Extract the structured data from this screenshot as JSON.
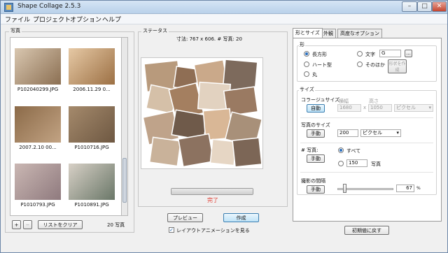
{
  "window": {
    "title": "Shape Collage 2.5.3"
  },
  "menu": [
    "ファイル",
    "プロジェクト",
    "オプション",
    "ヘルプ"
  ],
  "photos_panel": {
    "label": "写真",
    "items": [
      {
        "filename": "P102040299.JPG"
      },
      {
        "filename": "2006.11.29 0..."
      },
      {
        "filename": "2007.2.10 00..."
      },
      {
        "filename": "P1010716.JPG"
      },
      {
        "filename": "P1010793.JPG"
      },
      {
        "filename": "P1010891.JPG"
      }
    ],
    "add_label": "+",
    "remove_label": "−",
    "clear_label": "リストをクリア",
    "count_text": "20 写真"
  },
  "status_panel": {
    "label": "ステータス",
    "info": "寸法: 767 x 606. # 写真: 20",
    "progress": 1.0,
    "done_text": "完了",
    "preview_label": "プレビュー",
    "create_label": "作成",
    "animation_label": "レイアウトアニメーションを見る",
    "animation_checked": true
  },
  "tabs": [
    "形とサイズ",
    "外観",
    "高度なオプション"
  ],
  "shape_section": {
    "label": "形",
    "rect": "長方形",
    "text": "文字",
    "text_value": "G",
    "heart": "ハート型",
    "other": "そのほか",
    "circle": "丸",
    "create_shape_label": "形状を作成",
    "browse_label": "..."
  },
  "size_section": {
    "label": "サイズ",
    "collage_size_label": "コラージュサイズ",
    "auto_label": "自動",
    "width_label": "横幅",
    "height_label": "高さ",
    "width_value": "1680",
    "height_value": "1050",
    "times": "x",
    "unit_disabled": "ピクセル",
    "photo_size_label": "写真のサイズ",
    "manual_label": "手動",
    "photo_size_value": "200",
    "photo_unit": "ピクセル",
    "num_photos_label": "# 写真:",
    "all_label": "すべて",
    "num_value": "150",
    "num_unit": "写真",
    "spacing_label": "撮影の間隔",
    "spacing_value": "67",
    "spacing_unit": "%",
    "spacing_slider": 0.1
  },
  "reset_label": "初期値に戻す",
  "colors": {
    "accent": "#2a6fbf",
    "done": "#e03c31"
  }
}
